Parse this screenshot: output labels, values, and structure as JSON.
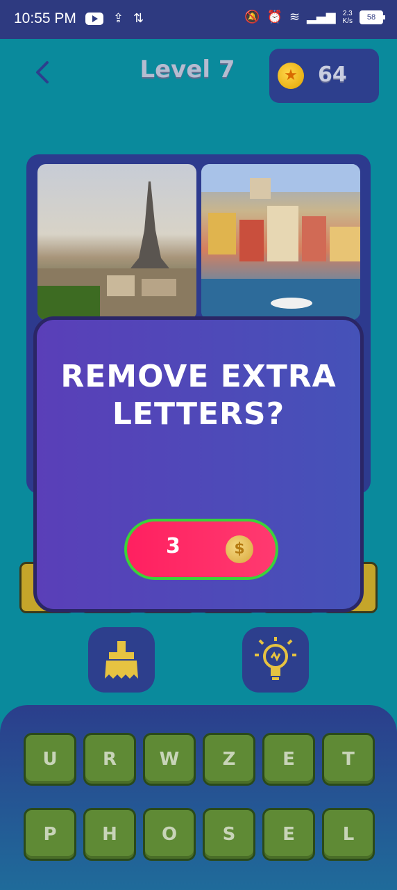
{
  "status_bar": {
    "time": "10:55 PM",
    "net_speed_value": "2.3",
    "net_speed_unit": "K/s",
    "battery": "58"
  },
  "header": {
    "level_title": "Level 7",
    "coins": "64"
  },
  "dialog": {
    "title": "REMOVE EXTRA LETTERS?",
    "cost": "3",
    "coin_symbol": "$"
  },
  "keyboard": {
    "rows": [
      [
        "U",
        "R",
        "W",
        "Z",
        "E",
        "T"
      ],
      [
        "P",
        "H",
        "O",
        "S",
        "E",
        "L"
      ]
    ]
  },
  "colors": {
    "background": "#0a8a9c",
    "panel": "#2d3f8d",
    "key_green": "#5f8a35",
    "cost_button": "#ff2060",
    "cost_border": "#3ad23a",
    "slot_gold": "#c5a52a"
  },
  "icons": {
    "back": "chevron-left-icon",
    "coin": "star-coin-icon",
    "broom": "broom-icon",
    "hint": "lightbulb-icon"
  }
}
